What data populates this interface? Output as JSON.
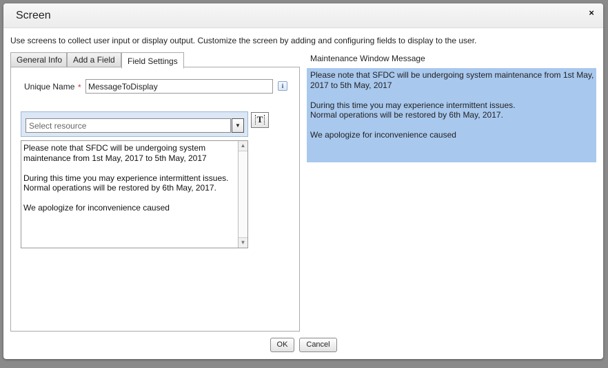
{
  "dialog": {
    "title": "Screen",
    "close_label": "×",
    "description": "Use screens to collect user input or display output. Customize the screen by adding and configuring fields to display to the user."
  },
  "tabs": [
    {
      "label": "General Info",
      "active": false
    },
    {
      "label": "Add a Field",
      "active": false
    },
    {
      "label": "Field Settings",
      "active": true
    }
  ],
  "field_settings": {
    "unique_name_label": "Unique Name",
    "required_marker": "*",
    "unique_name_value": "MessageToDisplay",
    "info_icon_label": "i",
    "resource_placeholder": "Select resource",
    "dropdown_arrow": "▼",
    "insert_icon_label": "T",
    "message_text": "Please note that SFDC will be undergoing system maintenance from 1st May, 2017 to 5th May, 2017\n\nDuring this time you may experience intermittent issues.\nNormal operations will be restored by 6th May, 2017.\n\nWe apologize for inconvenience caused",
    "scroll_up": "▲",
    "scroll_down": "▼"
  },
  "preview": {
    "label": "Maintenance Window Message",
    "text": "Please note that SFDC will be undergoing system maintenance from 1st May,\n2017 to 5th May, 2017\n\nDuring this time you may experience intermittent issues.\nNormal operations will be restored by 6th May, 2017.\n\nWe apologize for inconvenience caused",
    "background": "#a8c8ee"
  },
  "buttons": {
    "ok": "OK",
    "cancel": "Cancel"
  }
}
